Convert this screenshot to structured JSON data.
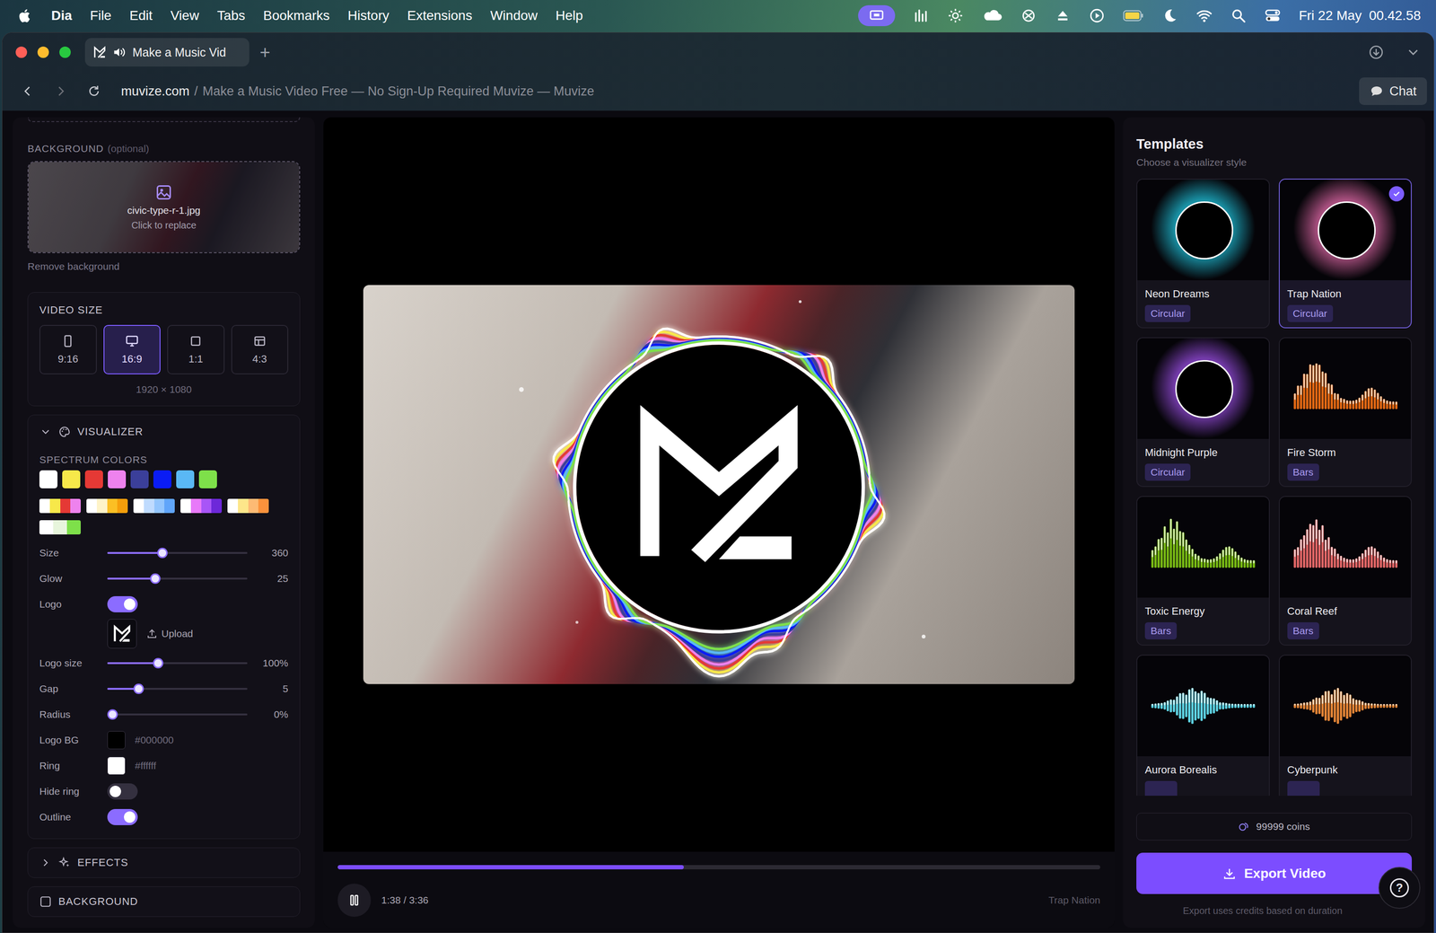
{
  "menubar": {
    "app": "Dia",
    "items": [
      "File",
      "Edit",
      "View",
      "Tabs",
      "Bookmarks",
      "History",
      "Extensions",
      "Window",
      "Help"
    ],
    "clock": "Fri 22 May  00.42.58"
  },
  "browser": {
    "tab": {
      "title": "Make a Music Vid",
      "playing_audio": true,
      "selected": true
    },
    "new_tab": "+",
    "address": {
      "domain": "muvize.com",
      "separator": "/",
      "page_title": "Make a Music Video Free — No Sign-Up Required Muvize — Muvize"
    },
    "chat_button": "Chat"
  },
  "sidebar": {
    "background": {
      "label": "BACKGROUND",
      "hint": "(optional)",
      "file_name": "civic-type-r-1.jpg",
      "action": "Click to replace",
      "remove": "Remove background"
    },
    "video_size": {
      "label": "VIDEO SIZE",
      "options": [
        {
          "label": "9:16",
          "selected": false
        },
        {
          "label": "16:9",
          "selected": true
        },
        {
          "label": "1:1",
          "selected": false
        },
        {
          "label": "4:3",
          "selected": false
        }
      ],
      "resolution": "1920 × 1080"
    },
    "visualizer": {
      "label": "VISUALIZER",
      "expanded": true,
      "spectrum_label": "SPECTRUM COLORS",
      "colors": [
        {
          "color": "#ffffff"
        },
        {
          "color": "#f7e84a"
        },
        {
          "color": "#e53935"
        },
        {
          "color": "#ee82ee"
        },
        {
          "color": "#3b3f9a"
        },
        {
          "color": "#0a1cf5"
        },
        {
          "color": "#5ab8f5"
        },
        {
          "color": "#7ee04a"
        }
      ],
      "palettes": [
        {
          "colors": [
            "#ffffff",
            "#f7e84a",
            "#e53935",
            "#ee82ee"
          ]
        },
        {
          "colors": [
            "#ffffff",
            "#fef3c7",
            "#fbbf24",
            "#f59e0b"
          ]
        },
        {
          "colors": [
            "#ffffff",
            "#bfdbfe",
            "#93c5fd",
            "#60a5fa"
          ]
        },
        {
          "colors": [
            "#ffffff",
            "#e879f9",
            "#a855f7",
            "#6d28d9"
          ]
        },
        {
          "colors": [
            "#ffffff",
            "#fde68a",
            "#fdba74",
            "#fb923c"
          ]
        },
        {
          "colors": [
            "#ffffff",
            "#e7f5dc",
            "#7ee04a"
          ]
        }
      ],
      "controls": [
        {
          "kind": "slider",
          "label": "Size",
          "value": "360",
          "level": 0.385
        },
        {
          "kind": "slider",
          "label": "Glow",
          "value": "25",
          "level": 0.33
        },
        {
          "kind": "toggle",
          "label": "Logo",
          "on": true
        },
        {
          "kind": "upload",
          "action": "Upload"
        },
        {
          "kind": "slider",
          "label": "Logo size",
          "value": "100%",
          "level": 0.35
        },
        {
          "kind": "slider",
          "label": "Gap",
          "value": "5",
          "level": 0.2
        },
        {
          "kind": "slider",
          "label": "Radius",
          "value": "0%",
          "level": 0
        },
        {
          "kind": "color",
          "label": "Logo BG",
          "value": "#000000",
          "color": "#000000"
        },
        {
          "kind": "color",
          "label": "Ring",
          "value": "#ffffff",
          "color": "#ffffff"
        },
        {
          "kind": "toggle",
          "label": "Hide ring",
          "on": false
        },
        {
          "kind": "toggle",
          "label": "Outline",
          "on": true
        }
      ]
    },
    "effects": {
      "label": "EFFECTS",
      "expanded": false
    },
    "next_section": {
      "label": "BACKGROUND"
    }
  },
  "player": {
    "playing": true,
    "progress": 0.454,
    "time": "1:38 / 3:36",
    "template": "Trap Nation"
  },
  "templates": {
    "title": "Templates",
    "subtitle": "Choose a visualizer style",
    "items": [
      {
        "name": "Neon Dreams",
        "tag": "Circular",
        "kind": "circular",
        "color": "#22d3ee",
        "selected": false
      },
      {
        "name": "Trap Nation",
        "tag": "Circular",
        "kind": "circular",
        "color": "#f472b6",
        "selected": true
      },
      {
        "name": "Midnight Purple",
        "tag": "Circular",
        "kind": "circular",
        "color": "#a855f7",
        "selected": false
      },
      {
        "name": "Fire Storm",
        "tag": "Bars",
        "kind": "bars",
        "color": "#f97316",
        "selected": false
      },
      {
        "name": "Toxic Energy",
        "tag": "Bars",
        "kind": "bars",
        "color": "#84cc16",
        "selected": false
      },
      {
        "name": "Coral Reef",
        "tag": "Bars",
        "kind": "bars",
        "color": "#f87171",
        "selected": false
      },
      {
        "name": "Aurora Borealis",
        "tag": null,
        "kind": "wave",
        "color": "#67e8f9",
        "selected": false
      },
      {
        "name": "Cyberpunk",
        "tag": null,
        "kind": "wave",
        "color": "#fb923c",
        "selected": false
      }
    ]
  },
  "footer": {
    "coins": "99999 coins",
    "export_button": "Export Video",
    "note": "Export uses credits based on duration",
    "help": "?"
  }
}
